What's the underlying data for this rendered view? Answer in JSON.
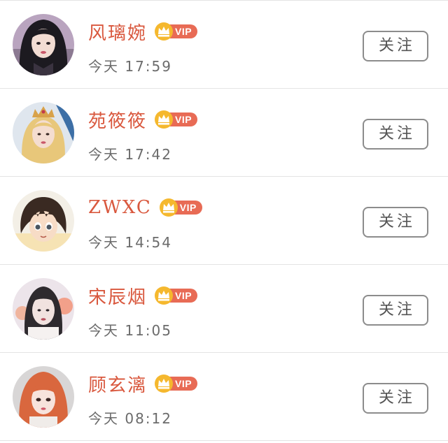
{
  "colors": {
    "name": "#d9583e",
    "vip_pill": "#e86b55",
    "crown": "#f5b82e",
    "time": "#6b6b6b",
    "button_border": "#8c8c8c",
    "divider": "#e4e4e4"
  },
  "follow_list": {
    "items": [
      {
        "name": "风璃婉",
        "vip_label": "VIP",
        "time": "今天 17:59",
        "button_label": "关注",
        "avatar_icon": "avatar-dark-hair-girl"
      },
      {
        "name": "苑筱筱",
        "vip_label": "VIP",
        "time": "今天 17:42",
        "button_label": "关注",
        "avatar_icon": "avatar-blonde-crown-girl"
      },
      {
        "name": "ZWXC",
        "vip_label": "VIP",
        "time": "今天 14:54",
        "button_label": "关注",
        "avatar_icon": "avatar-anime-boy"
      },
      {
        "name": "宋辰烟",
        "vip_label": "VIP",
        "time": "今天 11:05",
        "button_label": "关注",
        "avatar_icon": "avatar-pale-girl"
      },
      {
        "name": "顾玄漓",
        "vip_label": "VIP",
        "time": "今天 08:12",
        "button_label": "关注",
        "avatar_icon": "avatar-red-hair-girl"
      }
    ]
  }
}
